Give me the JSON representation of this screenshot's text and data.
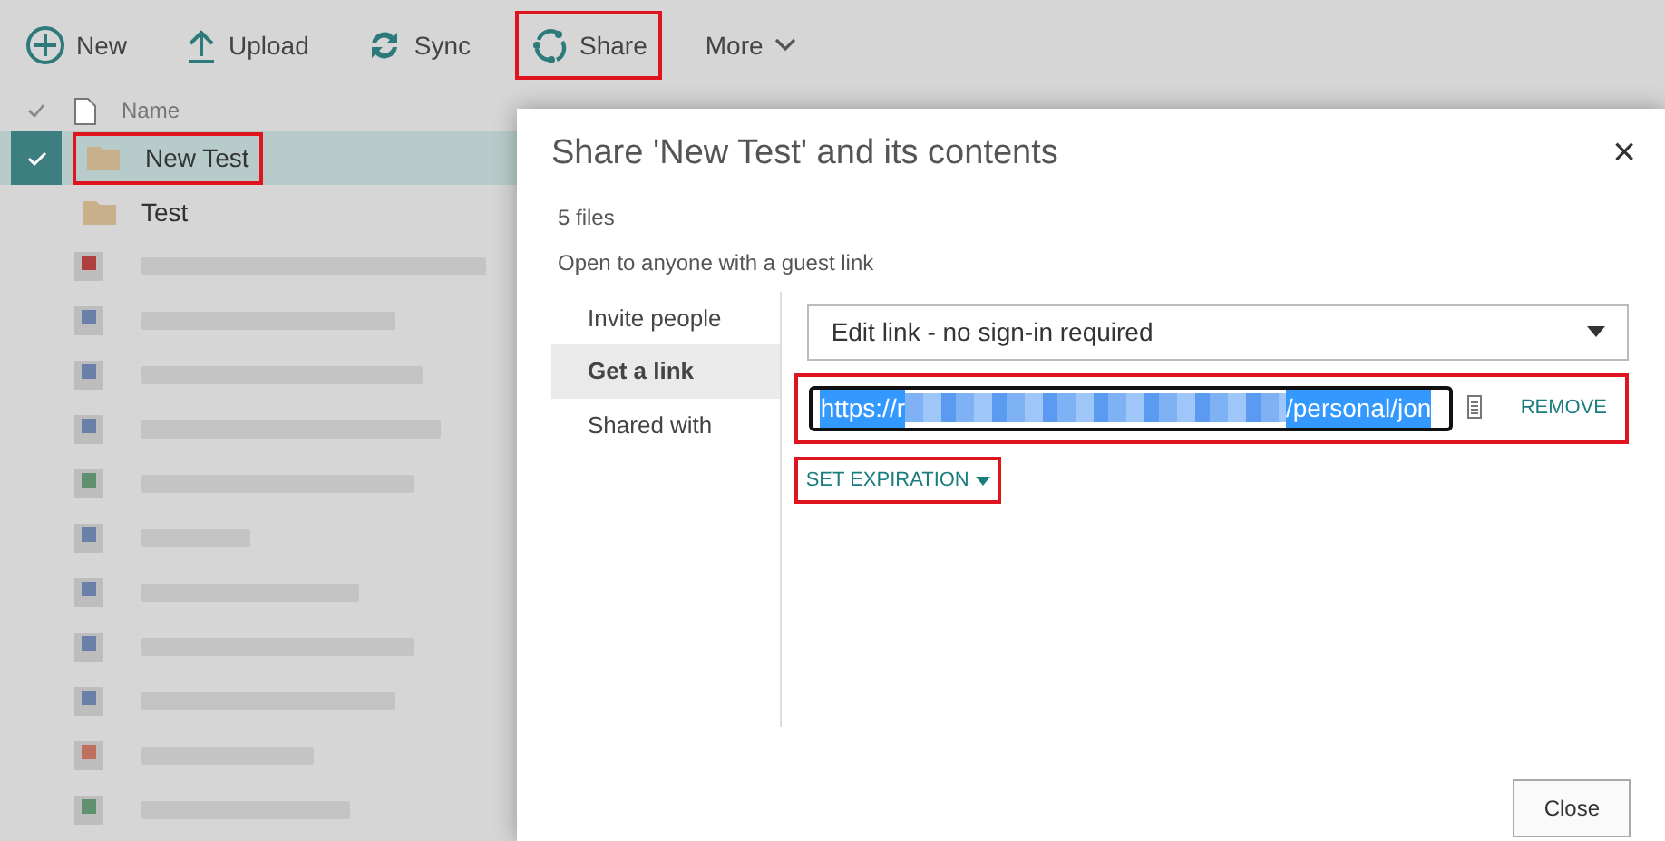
{
  "toolbar": [
    {
      "kind": "new",
      "label": "New",
      "highlighted": false
    },
    {
      "kind": "upload",
      "label": "Upload",
      "highlighted": false
    },
    {
      "kind": "sync",
      "label": "Sync",
      "highlighted": false
    },
    {
      "kind": "share",
      "label": "Share",
      "highlighted": true
    },
    {
      "kind": "more",
      "label": "More",
      "highlighted": false
    }
  ],
  "list": {
    "header": "Name",
    "folders": [
      {
        "name": "New Test",
        "selected": true,
        "highlighted": true
      },
      {
        "name": "Test",
        "selected": false,
        "highlighted": false
      }
    ],
    "redacted_files": [
      {
        "color": "#b04040"
      },
      {
        "color": "#6a80a8"
      },
      {
        "color": "#6a80a8"
      },
      {
        "color": "#6a80a8"
      },
      {
        "color": "#5f9070"
      },
      {
        "color": "#6a80a8"
      },
      {
        "color": "#6a80a8"
      },
      {
        "color": "#6a80a8"
      },
      {
        "color": "#6a80a8"
      },
      {
        "color": "#c07060"
      },
      {
        "color": "#5f9070"
      }
    ]
  },
  "dialog": {
    "title": "Share 'New Test' and its contents",
    "close": "×",
    "file_count": "5 files",
    "access": "Open to anyone with a guest link",
    "nav": [
      {
        "label": "Invite people",
        "selected": false
      },
      {
        "label": "Get a link",
        "selected": true
      },
      {
        "label": "Shared with",
        "selected": false
      }
    ],
    "link_type": "Edit link - no sign-in required",
    "link": {
      "url_start": "https://r",
      "url_end": "/personal/jon",
      "highlighted": true,
      "remove": "REMOVE"
    },
    "expiration": {
      "label": "SET EXPIRATION",
      "highlighted": true
    },
    "close_button": "Close"
  }
}
